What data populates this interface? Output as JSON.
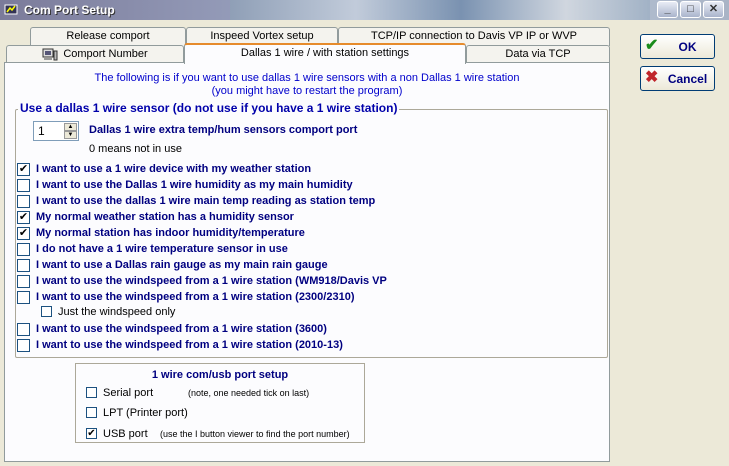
{
  "window": {
    "title": "Com Port Setup"
  },
  "tabs_row1": [
    {
      "label": "Release comport"
    },
    {
      "label": "Inspeed Vortex setup"
    },
    {
      "label": "TCP/IP connection to Davis VP IP or WVP"
    }
  ],
  "tabs_row2": [
    {
      "label": "Comport Number"
    },
    {
      "label": "Dallas 1 wire / with station settings"
    },
    {
      "label": "Data via TCP"
    }
  ],
  "info_line1": "The following is if you want to use dallas 1 wire sensors with a non Dallas 1 wire station",
  "info_line2": "(you might have to restart the program)",
  "group_title": "Use a dallas 1 wire sensor (do not use if you have a 1 wire station)",
  "comport": {
    "value": "1",
    "label": "Dallas 1 wire extra temp/hum sensors comport port",
    "note": "0 means not in use"
  },
  "options": [
    {
      "label": "I want to use a 1 wire device with my weather station",
      "checked": true
    },
    {
      "label": "I want to use the Dallas 1 wire humidity as my main humidity",
      "checked": false
    },
    {
      "label": "I want to use the dallas 1 wire main temp reading as station temp",
      "checked": false
    },
    {
      "label": "My normal weather station has a humidity sensor",
      "checked": true
    },
    {
      "label": "My normal station has indoor humidity/temperature",
      "checked": true
    },
    {
      "label": "I do not have a 1 wire temperature sensor in use",
      "checked": false
    },
    {
      "label": "I want to use a Dallas rain gauge as my main rain gauge",
      "checked": false
    },
    {
      "label": "I want to use the windspeed from a 1 wire station (WM918/Davis VP",
      "checked": false
    },
    {
      "label": "I want to use the windspeed from a 1 wire station (2300/2310)",
      "checked": false
    },
    {
      "label": "Just the windspeed only",
      "checked": false
    },
    {
      "label": "I want to use the windspeed from a 1 wire station (3600)",
      "checked": false
    },
    {
      "label": "I want to use the windspeed from a 1 wire station (2010-13)",
      "checked": false
    }
  ],
  "port_setup": {
    "title": "1 wire com/usb port setup",
    "items": [
      {
        "label": "Serial port",
        "note": "(note, one needed tick on last)",
        "checked": false
      },
      {
        "label": "LPT (Printer port)",
        "note": "",
        "checked": false
      },
      {
        "label": "USB port",
        "note": "(use the I button viewer to find the port number)",
        "checked": true
      }
    ]
  },
  "buttons": {
    "ok": "OK",
    "cancel": "Cancel"
  },
  "colors": {
    "label_navy": "#000080",
    "info_blue": "#0000cc",
    "ok_green": "#1a8c1a",
    "cancel_red": "#c0262b",
    "active_tab_accent": "#e68b2c"
  },
  "icons": {
    "app": "weather-app-icon",
    "minimize": "minimize-icon",
    "maximize": "maximize-icon",
    "close": "close-icon",
    "tab": "computer-icon",
    "ok": "checkmark-icon",
    "cancel": "x-mark-icon",
    "spinner_up": "up-arrow-icon",
    "spinner_down": "down-arrow-icon"
  }
}
